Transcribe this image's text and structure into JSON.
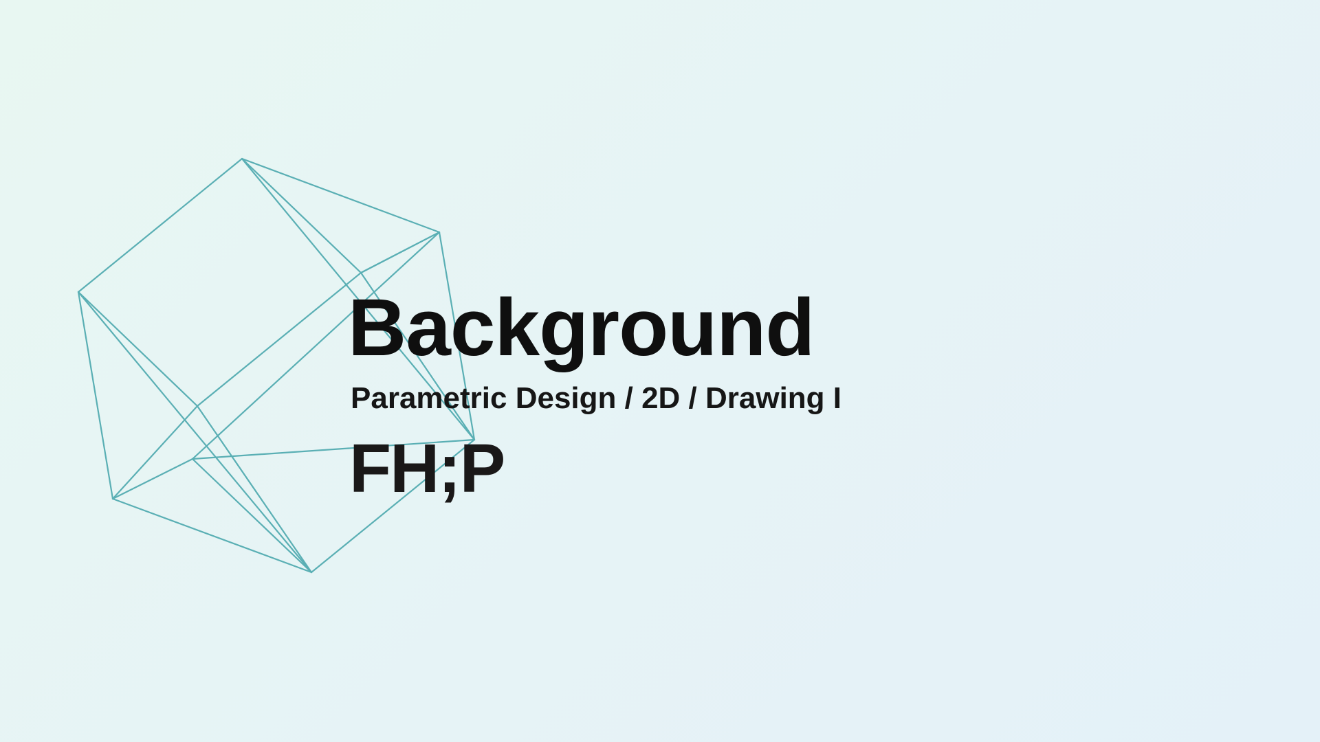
{
  "slide": {
    "title": "Background",
    "subtitle": "Parametric Design / 2D / Drawing I",
    "logo_text": "FH;P"
  },
  "colors": {
    "background_start": "#e8f7f2",
    "background_end": "#e4f1f8",
    "wireframe_stroke": "#5aafb4",
    "text": "#0f0f0f"
  },
  "icons": {
    "decoration": "wireframe-polyhedron-icon"
  }
}
